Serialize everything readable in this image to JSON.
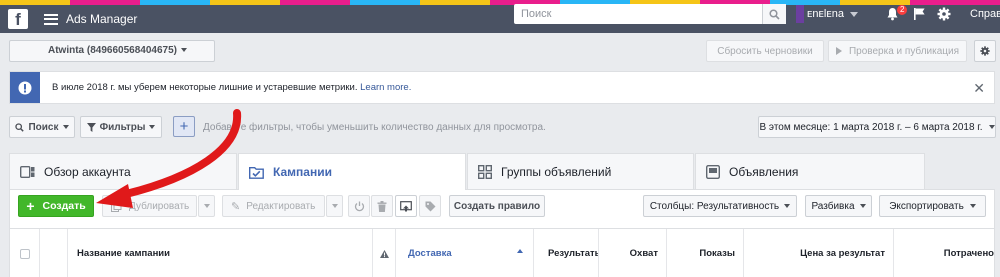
{
  "topbar": {
    "app_title": "Ads Manager",
    "search_placeholder": "Поиск",
    "user_name": "ᴇnᴇlᴇna",
    "notifications_count": "2",
    "help": "Справ"
  },
  "account": {
    "name": "Atwinta (849660568404675)",
    "discard_drafts": "Сбросить черновики",
    "review_publish": "Проверка и публикация"
  },
  "notice": {
    "text": "В июле 2018 г. мы уберем некоторые лишние и устаревшие метрики.",
    "link": "Learn more."
  },
  "filters": {
    "search": "Поиск",
    "filters": "Фильтры",
    "hint": "Добавьте фильтры, чтобы уменьшить количество данных для просмотра.",
    "date_range": "В этом месяце: 1 марта 2018 г. – 6 марта 2018 г."
  },
  "tabs": [
    {
      "label": "Обзор аккаунта"
    },
    {
      "label": "Кампании"
    },
    {
      "label": "Группы объявлений"
    },
    {
      "label": "Объявления"
    }
  ],
  "toolbar": {
    "create": "Создать",
    "duplicate": "Дублировать",
    "edit": "Редактировать",
    "create_rule": "Создать правило",
    "columns": "Столбцы: Результативность",
    "breakdown": "Разбивка",
    "export": "Экспортировать"
  },
  "table": {
    "columns": [
      "Название кампании",
      "Доставка",
      "Результаты",
      "Охват",
      "Показы",
      "Цена за результат",
      "Потрачено"
    ]
  },
  "colors": {
    "topbar": "#4a5263",
    "accent": "#4267b2",
    "create_green": "#42b72a",
    "annotation_red": "#e0191a"
  }
}
